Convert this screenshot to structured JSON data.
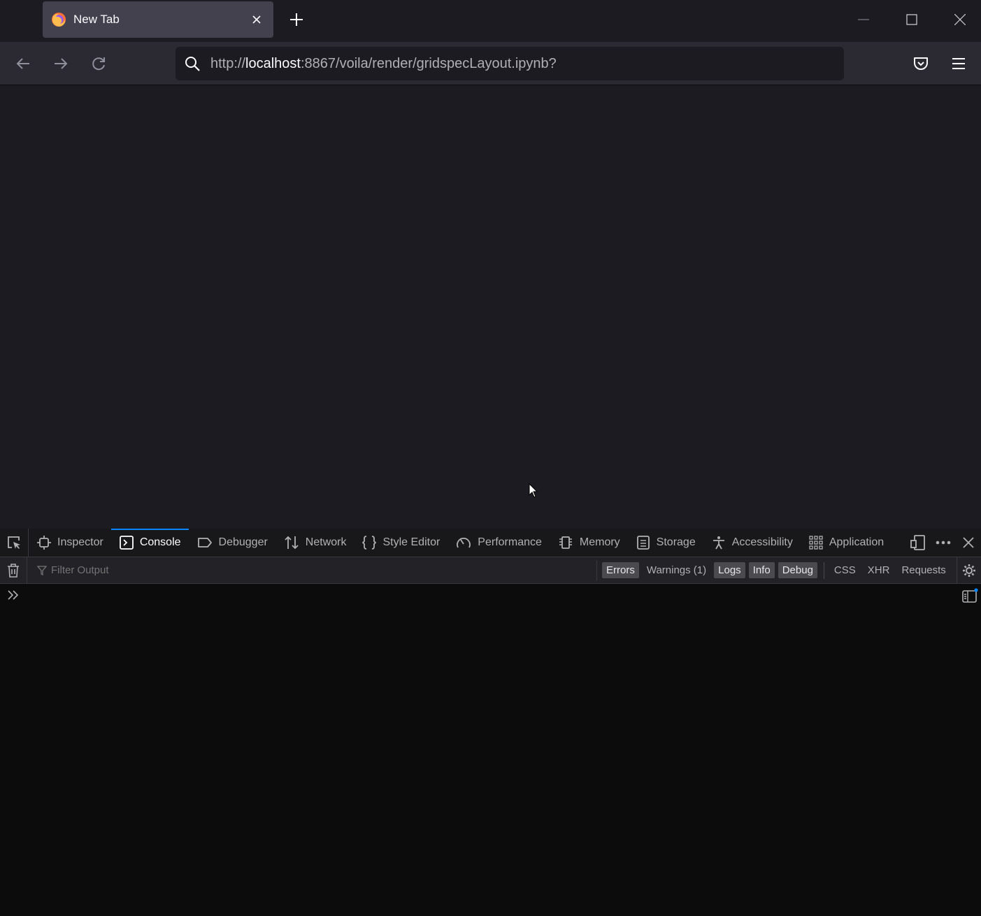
{
  "browser": {
    "tab": {
      "title": "New Tab",
      "favicon": "firefox-logo-icon"
    },
    "window_controls": [
      "minimize-icon",
      "maximize-icon",
      "close-icon"
    ],
    "url": {
      "scheme": "http://",
      "host": "localhost",
      "rest": ":8867/voila/render/gridspecLayout.ipynb?"
    }
  },
  "devtools": {
    "tabs": [
      {
        "label": "Inspector",
        "icon": "inspector-icon",
        "active": false
      },
      {
        "label": "Console",
        "icon": "console-icon",
        "active": true
      },
      {
        "label": "Debugger",
        "icon": "debugger-icon",
        "active": false
      },
      {
        "label": "Network",
        "icon": "network-icon",
        "active": false
      },
      {
        "label": "Style Editor",
        "icon": "style-editor-icon",
        "active": false
      },
      {
        "label": "Performance",
        "icon": "performance-icon",
        "active": false
      },
      {
        "label": "Memory",
        "icon": "memory-icon",
        "active": false
      },
      {
        "label": "Storage",
        "icon": "storage-icon",
        "active": false
      },
      {
        "label": "Accessibility",
        "icon": "accessibility-icon",
        "active": false
      },
      {
        "label": "Application",
        "icon": "application-icon",
        "active": false
      }
    ],
    "filter_placeholder": "Filter Output",
    "levels": [
      {
        "label": "Errors",
        "on": true
      },
      {
        "label": "Warnings (1)",
        "on": false
      },
      {
        "label": "Logs",
        "on": true
      },
      {
        "label": "Info",
        "on": true
      },
      {
        "label": "Debug",
        "on": true
      }
    ],
    "request_filters": [
      "CSS",
      "XHR",
      "Requests"
    ],
    "accent_color": "#0a84ff"
  }
}
